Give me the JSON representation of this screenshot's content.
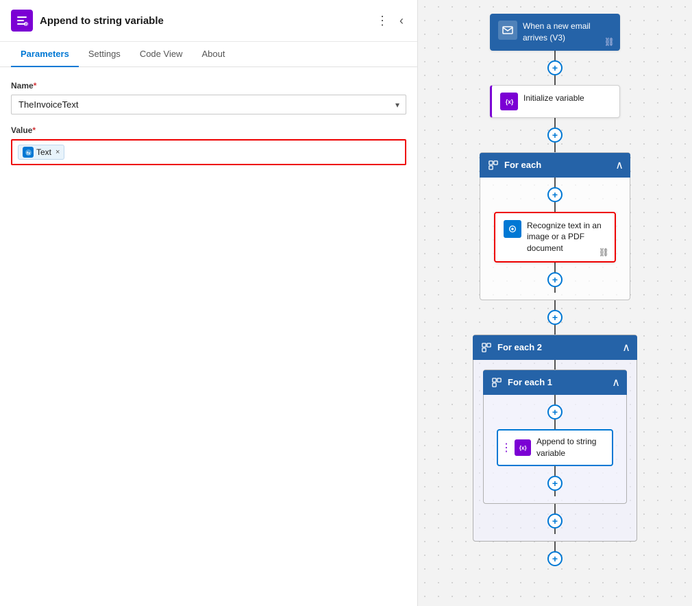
{
  "panel": {
    "title": "Append to string variable",
    "icon_label": "append-icon"
  },
  "tabs": [
    {
      "id": "parameters",
      "label": "Parameters",
      "active": true
    },
    {
      "id": "settings",
      "label": "Settings",
      "active": false
    },
    {
      "id": "codeview",
      "label": "Code View",
      "active": false
    },
    {
      "id": "about",
      "label": "About",
      "active": false
    }
  ],
  "form": {
    "name_label": "Name",
    "name_required": "*",
    "name_value": "TheInvoiceText",
    "value_label": "Value",
    "value_required": "*",
    "token_label": "Text",
    "token_close": "×"
  },
  "flow": {
    "node1": {
      "label": "When a new email arrives (V3)",
      "icon": "email-icon"
    },
    "node2": {
      "label": "Initialize variable",
      "icon": "variable-icon"
    },
    "foreach": {
      "label": "For each",
      "collapse": "∧"
    },
    "recognize_node": {
      "label": "Recognize text in an image or a PDF document",
      "icon": "recognize-icon"
    },
    "foreach2": {
      "label": "For each 2",
      "collapse": "∧"
    },
    "foreach1": {
      "label": "For each 1",
      "collapse": "∧"
    },
    "append_node": {
      "label": "Append to string variable",
      "icon": "append-icon"
    },
    "plus_label": "+"
  }
}
